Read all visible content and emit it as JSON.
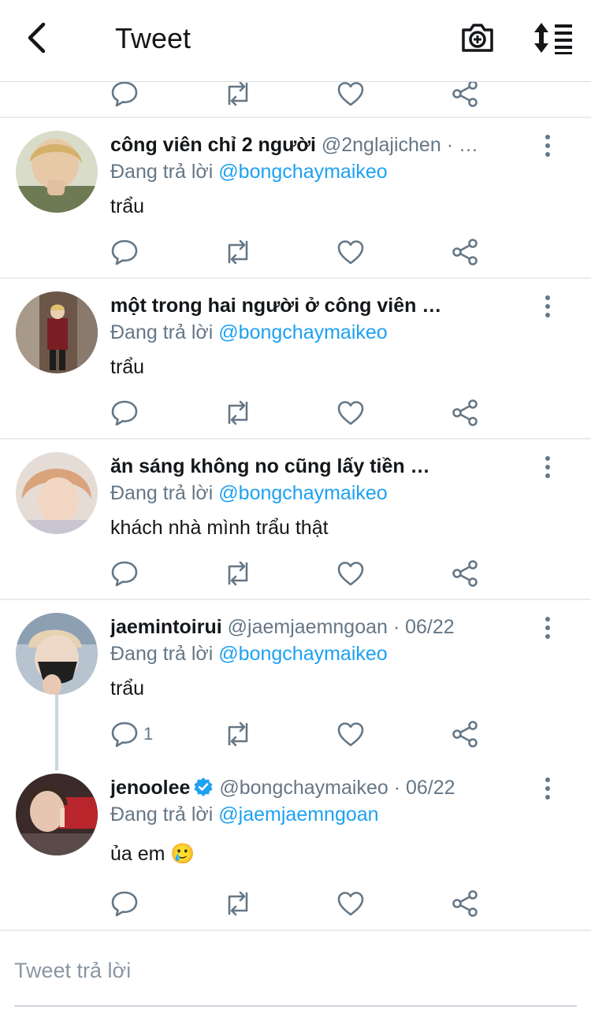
{
  "header": {
    "title": "Tweet",
    "back_icon": "chevron-left-icon",
    "camera_icon": "camera-plus-icon",
    "sort_icon": "sort-list-icon"
  },
  "reply_label": "Đang trả lời",
  "tweets": [
    {
      "name": "công viên chỉ 2 người",
      "handle": "@2nglajichen · …",
      "reply_to": "@bongchaymaikeo",
      "text": "trẩu",
      "reply_count": ""
    },
    {
      "name": "một trong hai người ở công viên …",
      "handle": "",
      "reply_to": "@bongchaymaikeo",
      "text": "trẩu",
      "reply_count": ""
    },
    {
      "name": "ăn sáng không no cũng lấy tiền …",
      "handle": "",
      "reply_to": "@bongchaymaikeo",
      "text": "khách nhà mình trẩu thật",
      "reply_count": ""
    },
    {
      "name": "jaemintoirui",
      "handle": "@jaemjaemngoan · 06/22",
      "reply_to": "@bongchaymaikeo",
      "text": "trẩu",
      "reply_count": "1"
    },
    {
      "name": "jenoolee",
      "handle": "@bongchaymaikeo · 06/22",
      "reply_to": "@jaemjaemngoan",
      "text": "ủa em 🥲",
      "reply_count": "",
      "verified": true
    }
  ],
  "compose": {
    "placeholder": "Tweet trả lời"
  },
  "colors": {
    "link": "#1da1f2",
    "secondary_text": "#657786",
    "verified": "#1da1f2",
    "divider": "#e6ecf0"
  }
}
